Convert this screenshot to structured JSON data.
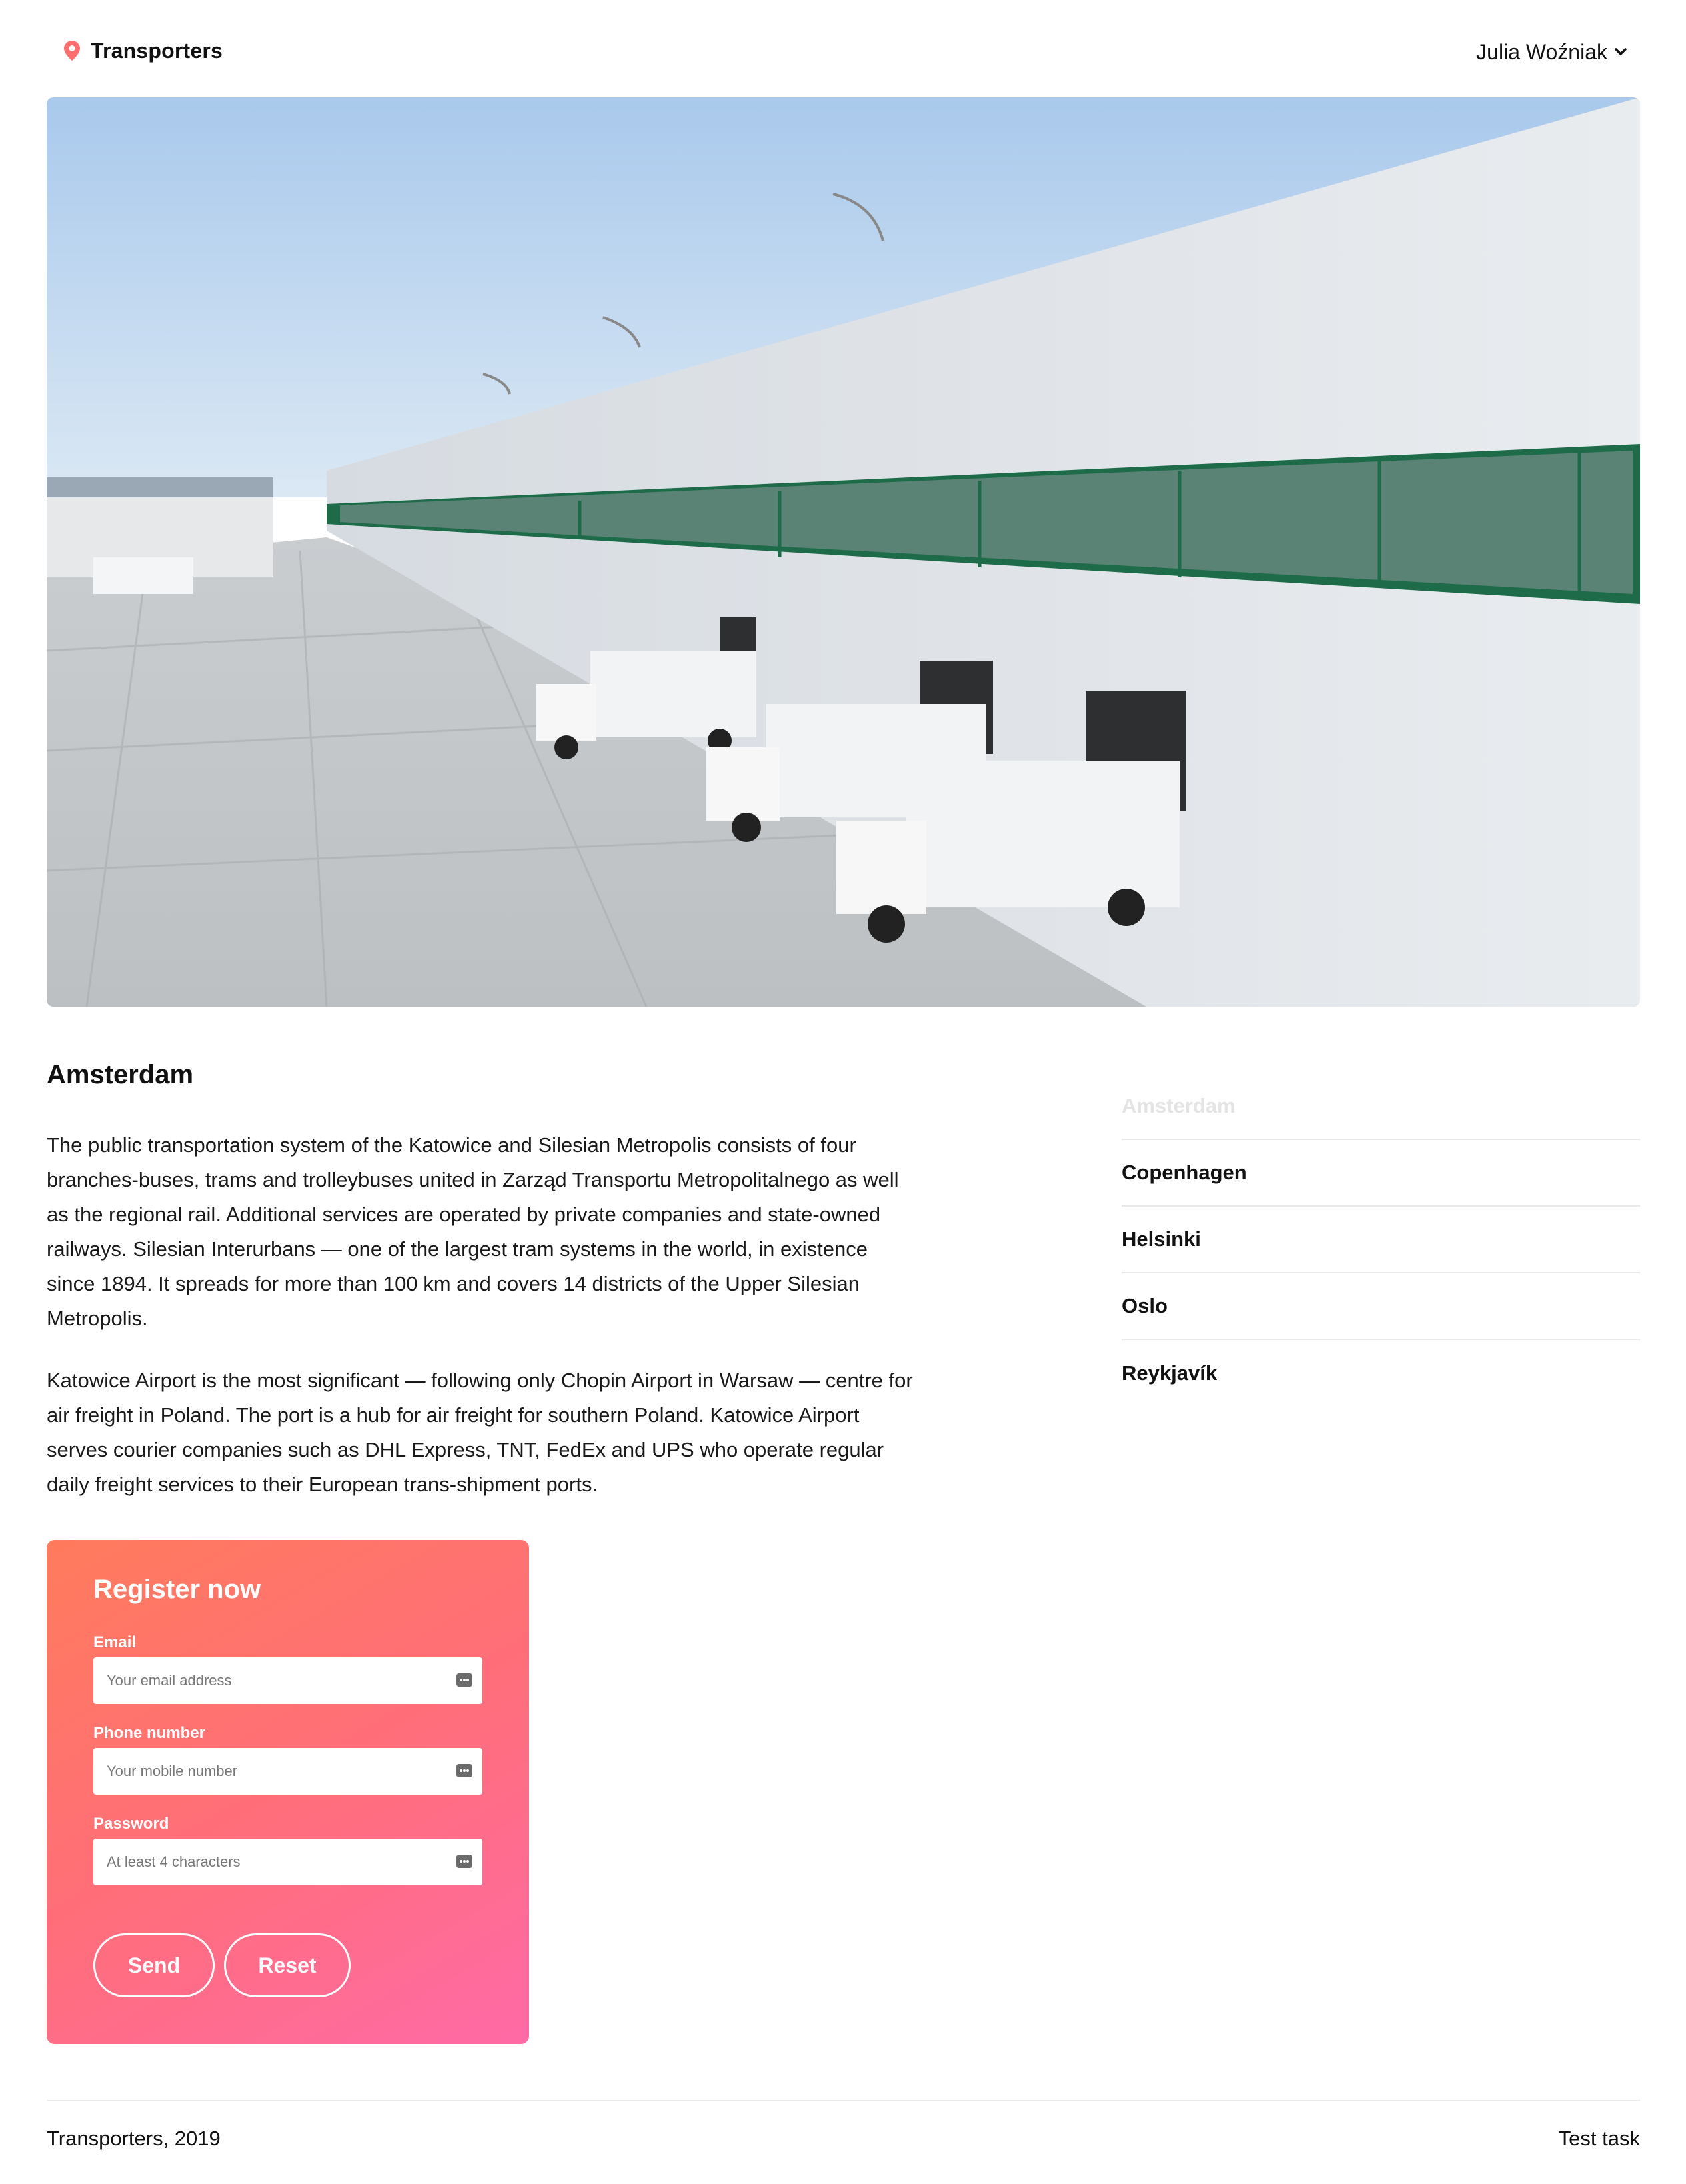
{
  "header": {
    "logo_text": "Transporters",
    "user_name": "Julia Woźniak"
  },
  "hero": {
    "icon": "warehouse-trucks-photo"
  },
  "main": {
    "city_title": "Amsterdam",
    "paragraphs": [
      "The public transportation system of the Katowice and Silesian Metropolis consists of four branches-buses, trams and trolleybuses united in Zarząd Transportu Metropolitalnego as well as the regional rail. Additional services are operated by private companies and state-owned railways. Silesian Interurbans — one of the largest tram systems in the world, in existence since 1894. It spreads for more than 100 km and covers 14 districts of the Upper Silesian Metropolis.",
      "Katowice Airport is the most significant — following only Chopin Airport in Warsaw — centre for air freight in Poland. The port is a hub for air freight for southern Poland. Katowice Airport serves courier companies such as DHL Express, TNT, FedEx and UPS who operate regular daily freight services to their European trans-shipment ports."
    ]
  },
  "cities": [
    {
      "label": "Amsterdam",
      "active": true
    },
    {
      "label": "Copenhagen",
      "active": false
    },
    {
      "label": "Helsinki",
      "active": false
    },
    {
      "label": "Oslo",
      "active": false
    },
    {
      "label": "Reykjavík",
      "active": false
    }
  ],
  "register": {
    "title": "Register now",
    "email_label": "Email",
    "email_placeholder": "Your email address",
    "email_value": "",
    "phone_label": "Phone number",
    "phone_placeholder": "Your mobile number",
    "phone_value": "",
    "password_label": "Password",
    "password_placeholder": "At least 4 characters",
    "password_value": "",
    "send_label": "Send",
    "reset_label": "Reset"
  },
  "footer": {
    "left": "Transporters, 2019",
    "right": "Test task"
  },
  "colors": {
    "accent": "#ff6e79",
    "gradient_start": "#ff7b5c",
    "gradient_end": "#ff6aa6",
    "pin": "#ff6f6f"
  }
}
